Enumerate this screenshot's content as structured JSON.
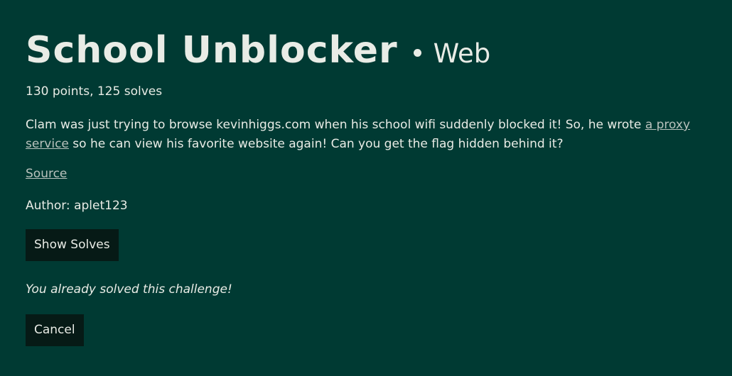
{
  "challenge": {
    "title": "School Unblocker",
    "category": "Web",
    "points_solves": "130 points, 125 solves",
    "description_part1": "Clam was just trying to browse kevinhiggs.com when his school wifi suddenly blocked it! So, he wrote ",
    "description_link": "a proxy service",
    "description_part2": " so he can view his favorite website again! Can you get the flag hidden behind it?",
    "source_link": "Source",
    "author": "Author: aplet123",
    "show_solves_label": "Show Solves",
    "solved_message": "You already solved this challenge!",
    "cancel_label": "Cancel"
  },
  "colors": {
    "background": "#003a33",
    "text": "#e9ece6",
    "button_bg": "#061a16",
    "link": "#b9c2bd"
  }
}
